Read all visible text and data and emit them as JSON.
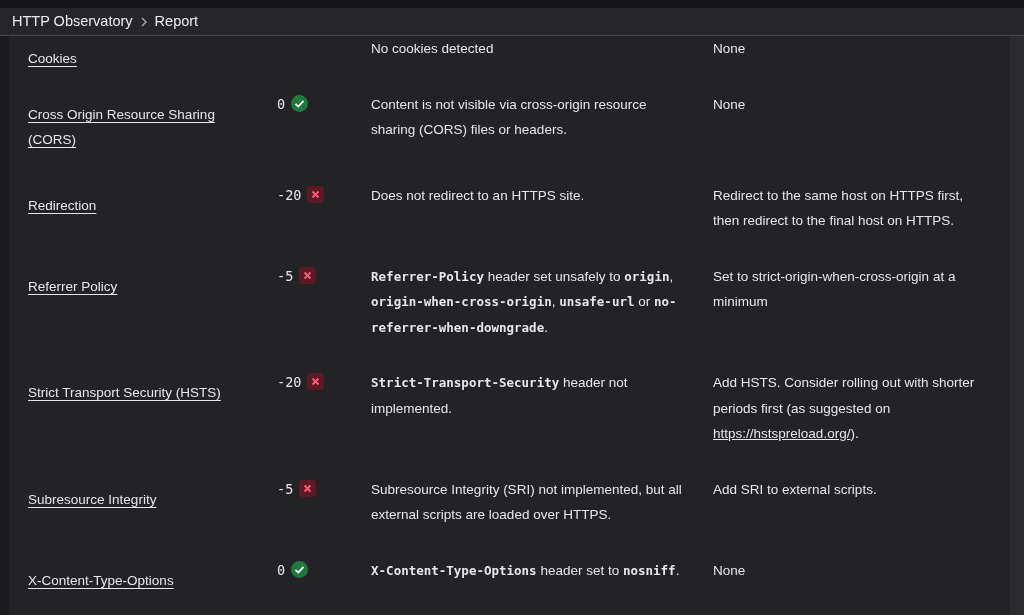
{
  "breadcrumb": [
    {
      "label": "HTTP Observatory"
    },
    {
      "label": "Report"
    }
  ],
  "tests": [
    {
      "name": "Cookies",
      "description": "No cookies detected",
      "advice": [
        {
          "kind": "text",
          "text": "None"
        }
      ]
    },
    {
      "name": "Cross Origin Resource Sharing (CORS)",
      "score": "0",
      "passed": true,
      "description": "Content is not visible via cross-origin resource sharing (CORS) files or headers.",
      "advice": [
        {
          "kind": "text",
          "text": "None"
        }
      ]
    },
    {
      "name": "Redirection",
      "score": "-20",
      "passed": false,
      "description": "Does not redirect to an HTTPS site.",
      "advice": [
        {
          "kind": "text",
          "text": "Redirect to the same host on HTTPS first, then redirect to the final host on HTTPS."
        }
      ]
    },
    {
      "name": "Referrer Policy",
      "score": "-5",
      "passed": false,
      "description": "**Referrer-Policy** header set unsafely to **origin**, **origin-when-cross-origin**, **unsafe-url** or **no-referrer-when-downgrade**.",
      "advice": [
        {
          "kind": "text",
          "text": "Set to strict-origin-when-cross-origin at a minimum"
        }
      ]
    },
    {
      "name": "Strict Transport Security (HSTS)",
      "score": "-20",
      "passed": false,
      "description": "**Strict-Transport-Security** header not implemented.",
      "advice": [
        {
          "kind": "text",
          "text": "Add HSTS. Consider rolling out with shorter periods first (as suggested on "
        },
        {
          "kind": "link",
          "text": "https://hstspreload.org/"
        },
        {
          "kind": "text",
          "text": ")."
        }
      ]
    },
    {
      "name": "Subresource Integrity",
      "score": "-5",
      "passed": false,
      "description": "Subresource Integrity (SRI) not implemented, but all external scripts are loaded over HTTPS.",
      "advice": [
        {
          "kind": "text",
          "text": "Add SRI to external scripts."
        }
      ]
    },
    {
      "name": "X-Content-Type-Options",
      "score": "0",
      "passed": true,
      "description": "**X-Content-Type-Options** header set to **nosniff**.",
      "advice": [
        {
          "kind": "text",
          "text": "None"
        }
      ]
    }
  ]
}
